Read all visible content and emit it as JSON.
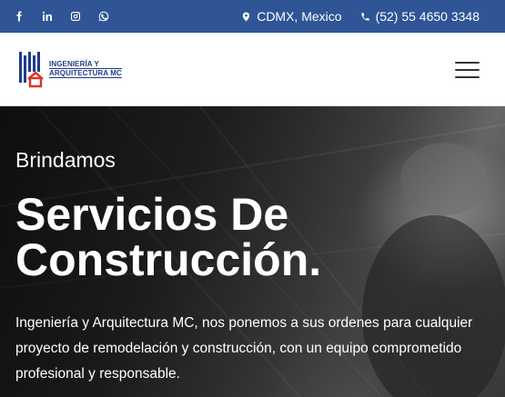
{
  "topbar": {
    "social": [
      {
        "name": "facebook-icon"
      },
      {
        "name": "linkedin-icon"
      },
      {
        "name": "instagram-icon"
      },
      {
        "name": "whatsapp-icon"
      }
    ],
    "location": "CDMX, Mexico",
    "phone": "(52) 55 4650 3348",
    "colors": {
      "background": "#2f5597",
      "text": "#ffffff"
    }
  },
  "navbar": {
    "logo_text_line1": "INGENIERÍA Y",
    "logo_text_line2": "ARQUITECTURA MC",
    "menu_icon": "hamburger-menu-icon"
  },
  "hero": {
    "subtitle": "Brindamos",
    "title_line1": "Servicios De",
    "title_line2": "Construcción.",
    "description": "Ingeniería y Arquitectura MC, nos ponemos a sus ordenes para cualquier proyecto de remodelación y construcción, con un equipo comprometido profesional y responsable."
  }
}
